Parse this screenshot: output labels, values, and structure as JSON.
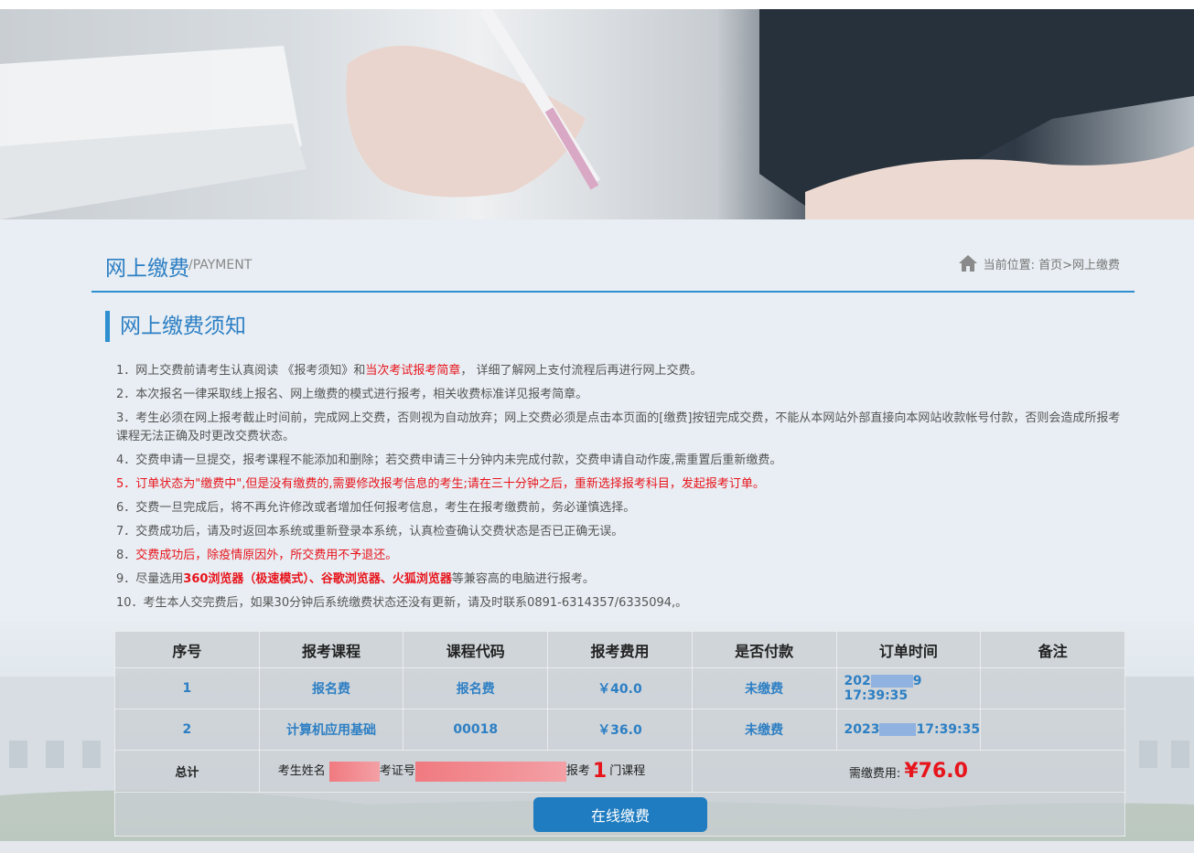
{
  "header": {
    "title": "网上缴费",
    "subtitle": "/PAYMENT",
    "breadcrumb": "当前位置: 首页>网上缴费"
  },
  "notice": {
    "title": "网上缴费须知",
    "items": {
      "i1_a": "1．网上交费前请考生认真阅读 《报考须知》和",
      "i1_b": "当次考试报考简章",
      "i1_c": "， 详细了解网上支付流程后再进行网上交费。",
      "i2": "2．本次报名一律采取线上报名、网上缴费的模式进行报考，相关收费标准详见报考简章。",
      "i3": "3．考生必须在网上报考截止时间前，完成网上交费，否则视为自动放弃；网上交费必须是点击本页面的[缴费]按钮完成交费，不能从本网站外部直接向本网站收款帐号付款，否则会造成所报考课程无法正确及时更改交费状态。",
      "i4": "4．交费申请一旦提交，报考课程不能添加和删除；若交费申请三十分钟内未完成付款，交费申请自动作废,需重置后重新缴费。",
      "i5": "5．订单状态为\"缴费中\",但是没有缴费的,需要修改报考信息的考生;请在三十分钟之后，重新选择报考科目，发起报考订单。",
      "i6": "6．交费一旦完成后，将不再允许修改或者增加任何报考信息，考生在报考缴费前，务必谨慎选择。",
      "i7": "7．交费成功后，请及时返回本系统或重新登录本系统，认真检查确认交费状态是否已正确无误。",
      "i8_a": "8．",
      "i8_b": "交费成功后，除疫情原因外，所交费用不予退还。",
      "i9_a": "9．尽量选用",
      "i9_b": "360浏览器（极速模式）、谷歌浏览器、火狐浏览器",
      "i9_c": "等兼容高的电脑进行报考。",
      "i10": "10．考生本人交完费后，如果30分钟后系统缴费状态还没有更新，请及时联系0891-6314357/6335094,。"
    }
  },
  "table": {
    "headers": [
      "序号",
      "报考课程",
      "课程代码",
      "报考费用",
      "是否付款",
      "订单时间",
      "备注"
    ],
    "rows": [
      {
        "no": "1",
        "course": "报名费",
        "code": "报名费",
        "fee": "￥40.0",
        "paid": "未缴费",
        "date_a": "202",
        "date_b": "9 17:39:35",
        "note": ""
      },
      {
        "no": "2",
        "course": "计算机应用基础",
        "code": "00018",
        "fee": "￥36.0",
        "paid": "未缴费",
        "date_a": "2023",
        "date_b": "17:39:35",
        "note": ""
      }
    ],
    "total": {
      "label": "总计",
      "name_label": "考生姓名",
      "id_label": "考证号",
      "apply_label": "报考",
      "course_count": "1",
      "course_unit": "门课程",
      "fee_label": "需缴费用:",
      "fee_value": "¥76.0"
    }
  },
  "pay_button": "在线缴费"
}
